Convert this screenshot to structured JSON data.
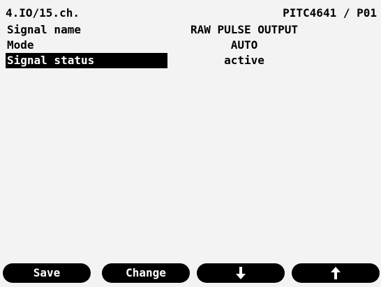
{
  "header": {
    "left": "4.IO/15.ch.",
    "right": "PITC4641 / P01"
  },
  "rows": [
    {
      "label": "Signal name",
      "value": "RAW PULSE OUTPUT"
    },
    {
      "label": "Mode",
      "value": "AUTO"
    },
    {
      "label": "Signal status",
      "value": "active",
      "selected": true
    }
  ],
  "softkeys": {
    "save": "Save",
    "change": "Change",
    "down_icon": "down-arrow-icon",
    "up_icon": "up-arrow-icon"
  },
  "colors": {
    "background": "#f3f3f3",
    "foreground": "#000000",
    "highlight_text": "#ffffff"
  }
}
